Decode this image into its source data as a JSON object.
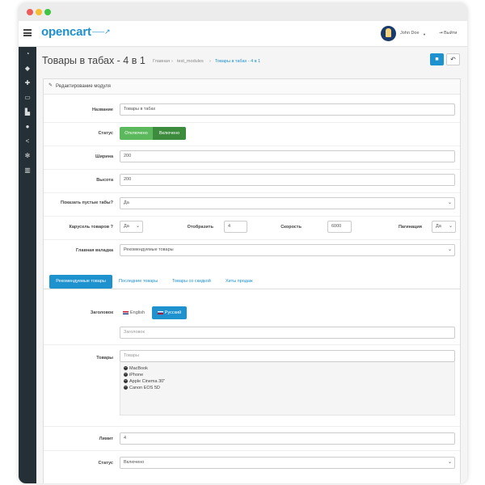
{
  "header": {
    "logo": "opencart",
    "logo_cart": "‒‒‒↗",
    "user": "John Doe",
    "logout": "Выйти"
  },
  "page": {
    "title": "Товары в табах - 4 в 1"
  },
  "breadcrumb": {
    "home": "Главная",
    "modules": "test_modules",
    "current": "Товары в табах - 4 в 1"
  },
  "panel": {
    "heading": "Редактирование модуля"
  },
  "form": {
    "name": {
      "label": "Название",
      "value": "Товары в табах"
    },
    "status": {
      "label": "Статус",
      "off": "Отключено",
      "on": "Включено"
    },
    "width": {
      "label": "Ширина",
      "value": "200"
    },
    "height": {
      "label": "Высота",
      "value": "200"
    },
    "show_empty": {
      "label": "Показать пустые табы?",
      "value": "Да"
    },
    "carousel": {
      "label": "Карусель товаров ?",
      "value": "Да"
    },
    "display": {
      "label": "Отобразить",
      "value": "4"
    },
    "speed": {
      "label": "Скорость",
      "value": "6000"
    },
    "pagination": {
      "label": "Пагинация",
      "value": "Да"
    },
    "main_tab": {
      "label": "Главная вкладка",
      "value": "Рекомендуемые товары"
    }
  },
  "tabs": [
    "Рекомендуемые товары",
    "Последние товары",
    "Товары со скидкой",
    "Хиты продаж"
  ],
  "tab_content": {
    "heading_label": "Заголовок",
    "languages": [
      "English",
      "Русский"
    ],
    "heading_placeholder": "Заголовок",
    "products_label": "Товары",
    "products_placeholder": "Товары",
    "products": [
      "MacBook",
      "iPhone",
      "Apple Cinema 30\"",
      "Canon EOS 5D"
    ],
    "limit_label": "Лимит",
    "limit_value": "4",
    "status_label": "Статус",
    "status_value": "Включено"
  }
}
